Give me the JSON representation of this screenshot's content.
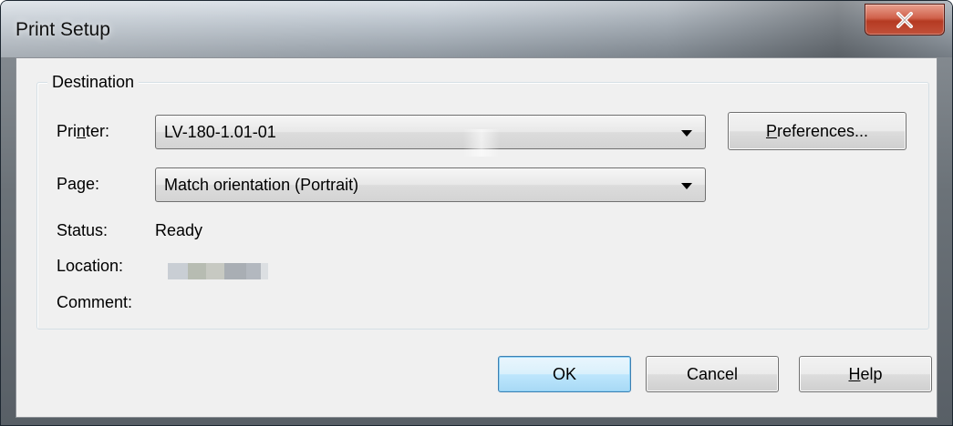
{
  "window": {
    "title": "Print Setup",
    "close_icon": "close-icon"
  },
  "destination": {
    "legend": "Destination",
    "printer": {
      "label_pre": "Pri",
      "label_mnemonic": "n",
      "label_post": "ter:",
      "value": "LV-180-1.01-01"
    },
    "page": {
      "label_pre": "Pa",
      "label_mnemonic": "g",
      "label_post": "e:",
      "value": "Match orientation (Portrait)"
    },
    "preferences_button": {
      "mnemonic": "P",
      "label_rest": "references..."
    },
    "status": {
      "label": "Status:",
      "value": "Ready"
    },
    "location": {
      "label": "Location:",
      "value_redacted": true
    },
    "comment": {
      "label": "Comment:",
      "value": ""
    }
  },
  "buttons": {
    "ok": "OK",
    "cancel": "Cancel",
    "help_mnemonic": "H",
    "help_rest": "elp"
  },
  "colors": {
    "default_button_border": "#3c7fb1",
    "close_button": "#c2513a",
    "client_bg": "#f0f0f0"
  }
}
